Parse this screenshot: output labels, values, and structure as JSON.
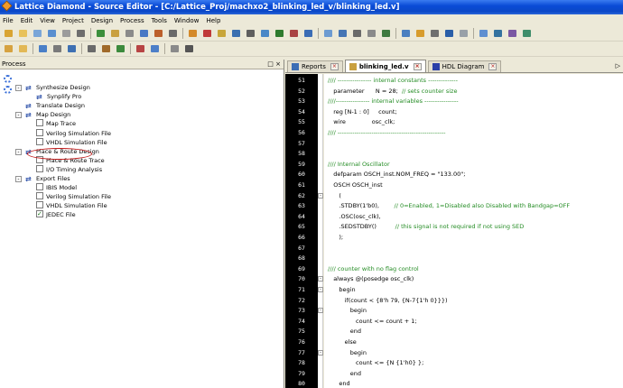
{
  "window": {
    "title": "Lattice Diamond - Source Editor - [C:/Lattice_Proj/machxo2_blinking_led_v/blinking_led.v]"
  },
  "menu": [
    "File",
    "Edit",
    "View",
    "Project",
    "Design",
    "Process",
    "Tools",
    "Window",
    "Help"
  ],
  "process_panel": {
    "title": "Process",
    "buttons": "□ ×",
    "tree": [
      {
        "label": "Synthesize Design",
        "level": 0,
        "icon": "sync",
        "expander": "-"
      },
      {
        "label": "Synplify Pro",
        "level": 1,
        "icon": "sync"
      },
      {
        "label": "Translate Design",
        "level": 0,
        "icon": "sync",
        "highlighted": true
      },
      {
        "label": "Map Design",
        "level": 0,
        "icon": "sync",
        "expander": "-"
      },
      {
        "label": "Map Trace",
        "level": 1,
        "icon": "box"
      },
      {
        "label": "Verilog Simulation File",
        "level": 1,
        "icon": "box"
      },
      {
        "label": "VHDL Simulation File",
        "level": 1,
        "icon": "box"
      },
      {
        "label": "Place & Route Design",
        "level": 0,
        "icon": "sync",
        "expander": "-"
      },
      {
        "label": "Place & Route Trace",
        "level": 1,
        "icon": "box"
      },
      {
        "label": "I/O Timing Analysis",
        "level": 1,
        "icon": "box"
      },
      {
        "label": "Export Files",
        "level": 0,
        "icon": "sync",
        "expander": "-"
      },
      {
        "label": "IBIS Model",
        "level": 1,
        "icon": "box"
      },
      {
        "label": "Verilog Simulation File",
        "level": 1,
        "icon": "box"
      },
      {
        "label": "VHDL Simulation File",
        "level": 1,
        "icon": "box"
      },
      {
        "label": "JEDEC File",
        "level": 1,
        "icon": "check"
      }
    ]
  },
  "tabs": [
    {
      "label": "Reports",
      "icon": "reports-icon",
      "active": false
    },
    {
      "label": "blinking_led.v",
      "icon": "verilog-file-icon",
      "active": true
    },
    {
      "label": "HDL Diagram",
      "icon": "diagram-icon",
      "active": false
    }
  ],
  "tab_corner": "▷",
  "editor": {
    "lines": [
      {
        "n": "51",
        "text": "//// ---------------- internal constants --------------",
        "cls": "cm"
      },
      {
        "n": "52",
        "text": "   parameter      N = 28;  // sets counter size",
        "cls": "mix1"
      },
      {
        "n": "53",
        "text": "////---------------- internal variables ----------------",
        "cls": "cm"
      },
      {
        "n": "54",
        "text": "   reg [N-1 : 0]     count;",
        "cls": "kw"
      },
      {
        "n": "55",
        "text": "   wire              osc_clk;",
        "cls": "kw"
      },
      {
        "n": "56",
        "text": "//// ---------------------------------------------------",
        "cls": "cm"
      },
      {
        "n": "57",
        "text": "",
        "cls": "kw"
      },
      {
        "n": "58",
        "text": "",
        "cls": "kw"
      },
      {
        "n": "59",
        "text": "//// Internal Oscillator",
        "cls": "cm"
      },
      {
        "n": "60",
        "text": "   defparam OSCH_inst.NOM_FREQ = \"133.00\";",
        "cls": "kw"
      },
      {
        "n": "61",
        "text": "   OSCH OSCH_inst",
        "cls": "kw"
      },
      {
        "n": "62",
        "text": "      (",
        "cls": "kw"
      },
      {
        "n": "63",
        "text": "      .STDBY(1'b0),        // 0=Enabled, 1=Disabled also Disabled with Bandgap=OFF",
        "cls": "mix2"
      },
      {
        "n": "64",
        "text": "      .OSC(osc_clk),",
        "cls": "kw"
      },
      {
        "n": "65",
        "text": "      .SEDSTDBY()          // this signal is not required if not using SED",
        "cls": "mix3"
      },
      {
        "n": "66",
        "text": "      );",
        "cls": "kw"
      },
      {
        "n": "67",
        "text": "",
        "cls": "kw"
      },
      {
        "n": "68",
        "text": "",
        "cls": "kw"
      },
      {
        "n": "69",
        "text": "//// counter with no flag control",
        "cls": "cm"
      },
      {
        "n": "70",
        "text": "   always @(posedge osc_clk)",
        "cls": "kw"
      },
      {
        "n": "71",
        "text": "      begin",
        "cls": "kw"
      },
      {
        "n": "72",
        "text": "         if(count < {8'h 79, {N-7{1'h 0}}})",
        "cls": "kw"
      },
      {
        "n": "73",
        "text": "            begin",
        "cls": "kw"
      },
      {
        "n": "74",
        "text": "               count <= count + 1;",
        "cls": "kw"
      },
      {
        "n": "75",
        "text": "            end",
        "cls": "kw"
      },
      {
        "n": "76",
        "text": "         else",
        "cls": "kw"
      },
      {
        "n": "77",
        "text": "            begin",
        "cls": "kw"
      },
      {
        "n": "78",
        "text": "               count <= {N {1'h0} };",
        "cls": "kw"
      },
      {
        "n": "79",
        "text": "            end",
        "cls": "kw"
      },
      {
        "n": "80",
        "text": "      end",
        "cls": "kw"
      }
    ],
    "split_comments": {
      "52": {
        "code": "   parameter      N = 28;  ",
        "comment": "// sets counter size"
      },
      "63": {
        "code": "      .STDBY(1'b0),        ",
        "comment": "// 0=Enabled, 1=Disabled also Disabled with Bandgap=OFF"
      },
      "65": {
        "code": "      .SEDSTDBY()          ",
        "comment": "// this signal is not required if not using SED"
      }
    }
  },
  "colors": {
    "title_bar": "#0a4bd6",
    "comment": "#228b22",
    "gutter": "#000000",
    "highlight_circle": "#c01818"
  }
}
